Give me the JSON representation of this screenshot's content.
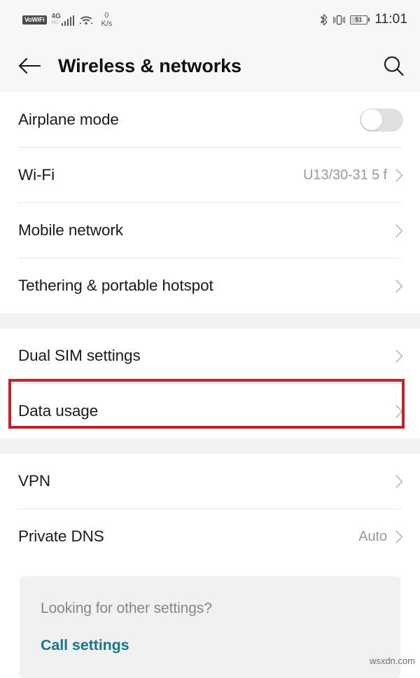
{
  "status_bar": {
    "vowifi_badge": "VoWiFi",
    "network_type": "4G",
    "network_subtype": "HD",
    "wifi_icon": "wifi-icon",
    "data_speed_value": "0",
    "data_speed_unit": "K/s",
    "bluetooth_icon": "bluetooth-icon",
    "vibrate_icon": "vibrate-icon",
    "battery_level": "51",
    "time": "11:01"
  },
  "app_bar": {
    "back_icon": "back-arrow-icon",
    "title": "Wireless & networks",
    "search_icon": "search-icon"
  },
  "groups": [
    {
      "rows": [
        {
          "label": "Airplane mode",
          "value": "",
          "control": "toggle",
          "toggle_on": false
        },
        {
          "label": "Wi-Fi",
          "value": "U13/30-31 5 f",
          "control": "chevron"
        },
        {
          "label": "Mobile network",
          "value": "",
          "control": "chevron"
        },
        {
          "label": "Tethering & portable hotspot",
          "value": "",
          "control": "chevron"
        }
      ]
    },
    {
      "rows": [
        {
          "label": "Dual SIM settings",
          "value": "",
          "control": "chevron"
        },
        {
          "label": "Data usage",
          "value": "",
          "control": "chevron",
          "highlighted": true
        }
      ]
    },
    {
      "rows": [
        {
          "label": "VPN",
          "value": "",
          "control": "chevron"
        },
        {
          "label": "Private DNS",
          "value": "Auto",
          "control": "chevron"
        }
      ]
    }
  ],
  "footer": {
    "question": "Looking for other settings?",
    "link": "Call settings"
  },
  "watermark": "wsxdn.com",
  "colors": {
    "highlight_border": "#c8202a",
    "link_teal": "#16788c",
    "header_bg": "#f7f7f7",
    "separator_bg": "#f2f2f2",
    "card_bg": "#f1f1f1"
  }
}
